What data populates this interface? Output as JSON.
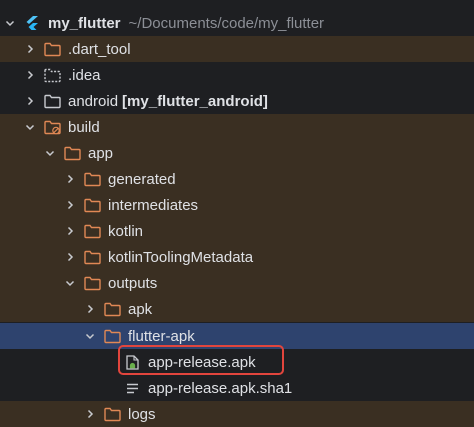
{
  "project": {
    "name": "my_flutter",
    "path": "~/Documents/code/my_flutter"
  },
  "items": {
    "dart_tool": ".dart_tool",
    "idea": ".idea",
    "android": "android",
    "android_module": "[my_flutter_android]",
    "build": "build",
    "app": "app",
    "generated": "generated",
    "intermediates": "intermediates",
    "kotlin": "kotlin",
    "kotlinToolingMetadata": "kotlinToolingMetadata",
    "outputs": "outputs",
    "apk": "apk",
    "flutter_apk": "flutter-apk",
    "app_release_apk": "app-release.apk",
    "app_release_sha1": "app-release.apk.sha1",
    "logs": "logs"
  },
  "colors": {
    "background": "#1e1f22",
    "excluded_folder_row": "#3a2f22",
    "selected_row": "#2e436e",
    "folder_icon": "#e08855",
    "highlight_border": "#e2453d",
    "flutter_blue": "#4fc3f7",
    "android_green": "#6ab04c"
  },
  "icons": {
    "expanded": "chevron-down-icon",
    "collapsed": "chevron-right-icon",
    "folder": "folder-icon",
    "android_file": "android-apk-file-icon",
    "text_file": "text-file-icon",
    "flutter": "flutter-icon"
  }
}
